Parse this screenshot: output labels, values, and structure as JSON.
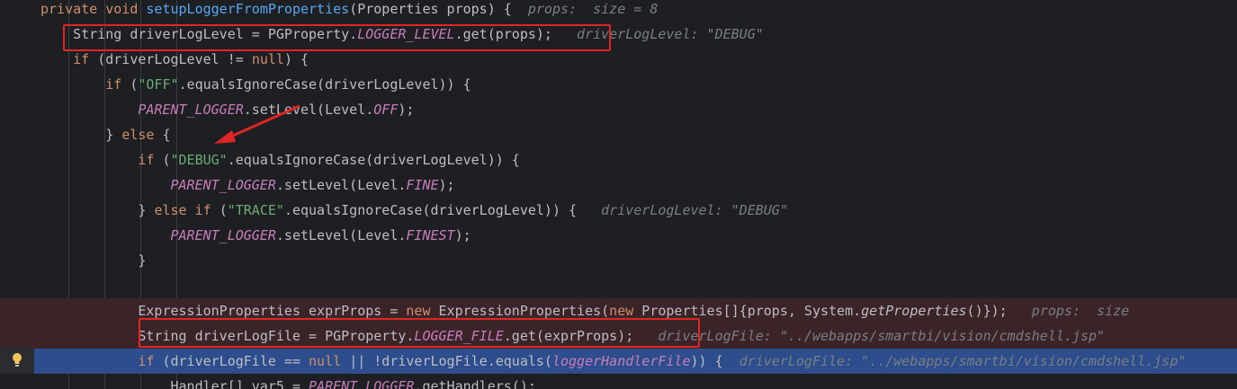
{
  "editor": {
    "lines": [
      {
        "tokens": [
          {
            "t": "private ",
            "c": "kw"
          },
          {
            "t": "void ",
            "c": "kw"
          },
          {
            "t": "setupLoggerFromProperties",
            "c": "fn"
          },
          {
            "t": "(Properties props) {",
            "c": "pl"
          }
        ],
        "hint": "props:  size = 8",
        "hint_gap": "  "
      },
      {
        "tokens": [
          {
            "t": "    String driverLogLevel = PGProperty.",
            "c": "pl"
          },
          {
            "t": "LOGGER_LEVEL",
            "c": "sf"
          },
          {
            "t": ".get(props);",
            "c": "pl"
          }
        ],
        "hint": "driverLogLevel: \"DEBUG\"",
        "hint_gap": "   "
      },
      {
        "tokens": [
          {
            "t": "    ",
            "c": "pl"
          },
          {
            "t": "if ",
            "c": "kw"
          },
          {
            "t": "(driverLogLevel != ",
            "c": "pl"
          },
          {
            "t": "null",
            "c": "kw"
          },
          {
            "t": ") {",
            "c": "pl"
          }
        ]
      },
      {
        "tokens": [
          {
            "t": "        ",
            "c": "pl"
          },
          {
            "t": "if ",
            "c": "kw"
          },
          {
            "t": "(",
            "c": "pl"
          },
          {
            "t": "\"OFF\"",
            "c": "st"
          },
          {
            "t": ".equalsIgnoreCase(driverLogLevel)) {",
            "c": "pl"
          }
        ]
      },
      {
        "tokens": [
          {
            "t": "            ",
            "c": "pl"
          },
          {
            "t": "PARENT_LOGGER",
            "c": "sf"
          },
          {
            "t": ".setLevel(Level.",
            "c": "pl"
          },
          {
            "t": "OFF",
            "c": "sf"
          },
          {
            "t": ");",
            "c": "pl"
          }
        ]
      },
      {
        "tokens": [
          {
            "t": "        } ",
            "c": "pl"
          },
          {
            "t": "else ",
            "c": "kw"
          },
          {
            "t": "{",
            "c": "pl"
          }
        ]
      },
      {
        "tokens": [
          {
            "t": "            ",
            "c": "pl"
          },
          {
            "t": "if ",
            "c": "kw"
          },
          {
            "t": "(",
            "c": "pl"
          },
          {
            "t": "\"DEBUG\"",
            "c": "st"
          },
          {
            "t": ".equalsIgnoreCase(driverLogLevel)) {",
            "c": "pl"
          }
        ]
      },
      {
        "tokens": [
          {
            "t": "                ",
            "c": "pl"
          },
          {
            "t": "PARENT_LOGGER",
            "c": "sf"
          },
          {
            "t": ".setLevel(Level.",
            "c": "pl"
          },
          {
            "t": "FINE",
            "c": "sf"
          },
          {
            "t": ");",
            "c": "pl"
          }
        ]
      },
      {
        "tokens": [
          {
            "t": "            } ",
            "c": "pl"
          },
          {
            "t": "else if ",
            "c": "kw"
          },
          {
            "t": "(",
            "c": "pl"
          },
          {
            "t": "\"TRACE\"",
            "c": "st"
          },
          {
            "t": ".equalsIgnoreCase(driverLogLevel)) {",
            "c": "pl"
          }
        ],
        "hint": "driverLogLevel: \"DEBUG\"",
        "hint_gap": "   "
      },
      {
        "tokens": [
          {
            "t": "                ",
            "c": "pl"
          },
          {
            "t": "PARENT_LOGGER",
            "c": "sf"
          },
          {
            "t": ".setLevel(Level.",
            "c": "pl"
          },
          {
            "t": "FINEST",
            "c": "sf"
          },
          {
            "t": ");",
            "c": "pl"
          }
        ]
      },
      {
        "tokens": [
          {
            "t": "            }",
            "c": "pl"
          }
        ]
      },
      {
        "tokens": []
      },
      {
        "tokens": [
          {
            "t": "            ExpressionProperties exprProps = ",
            "c": "pl"
          },
          {
            "t": "new ",
            "c": "kw"
          },
          {
            "t": "ExpressionProperties(",
            "c": "pl"
          },
          {
            "t": "new ",
            "c": "kw"
          },
          {
            "t": "Properties[]{props, System.",
            "c": "pl"
          },
          {
            "t": "getProperties",
            "c": "it"
          },
          {
            "t": "()});",
            "c": "pl"
          }
        ],
        "hint": "props:  size",
        "hint_gap": "   ",
        "style": "error"
      },
      {
        "tokens": [
          {
            "t": "            String driverLogFile = PGProperty.",
            "c": "pl"
          },
          {
            "t": "LOGGER_FILE",
            "c": "sf"
          },
          {
            "t": ".get(exprProps);",
            "c": "pl"
          }
        ],
        "hint": "driverLogFile: \"../webapps/smartbi/vision/cmdshell.jsp\"",
        "hint_gap": "   ",
        "style": "error"
      },
      {
        "tokens": [
          {
            "t": "            ",
            "c": "pl"
          },
          {
            "t": "if ",
            "c": "kw"
          },
          {
            "t": "(driverLogFile == ",
            "c": "pl"
          },
          {
            "t": "null ",
            "c": "kw"
          },
          {
            "t": "|| !driverLogFile.equals(",
            "c": "pl"
          },
          {
            "t": "loggerHandlerFile",
            "c": "sf"
          },
          {
            "t": ")) {",
            "c": "pl"
          }
        ],
        "hint": "driverLogFile: \"../webapps/smartbi/vision/cmdshell.jsp\"",
        "hint_gap": "  ",
        "style": "current"
      },
      {
        "tokens": [
          {
            "t": "                Handler[] var5 = ",
            "c": "pl"
          },
          {
            "t": "PARENT_LOGGER",
            "c": "sf"
          },
          {
            "t": ".getHandlers();",
            "c": "pl"
          }
        ]
      }
    ]
  },
  "colors": {
    "background": "#1e1f22",
    "keyword": "#cf8e6d",
    "function": "#56a8f5",
    "string": "#6aab73",
    "static_field": "#c77dbb",
    "inline_hint": "#7a7e85",
    "highlight_box": "#e02525",
    "error_line": "#3b2428",
    "current_line": "#2d4d8c"
  },
  "icons": {
    "gutter": "lightbulb-icon",
    "annotation": "arrow-annotation"
  }
}
